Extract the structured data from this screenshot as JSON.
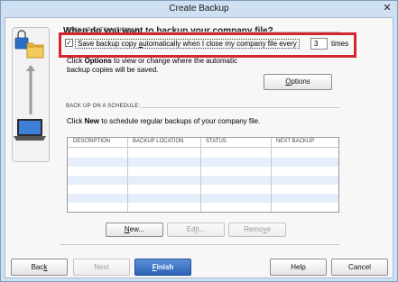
{
  "window": {
    "title": "Create Backup",
    "close_glyph": "✕"
  },
  "heading": "When do you want to backup your company file?",
  "auto_section": {
    "label": "BACK UP AUTOMATICALLY:",
    "checkbox_checked": true,
    "checkbox_mark": "✓",
    "checkbox_label_before": "Save backup copy ",
    "checkbox_label_mnemonic": "a",
    "checkbox_label_after": "utomatically when I close my company file every",
    "times_value": "3",
    "times_label": "times",
    "info_before": "Click ",
    "info_bold": "Options",
    "info_after": " to view or change where the automatic backup copies will be saved.",
    "options_button_mnemonic": "O",
    "options_button_rest": "ptions"
  },
  "schedule_section": {
    "label": "BACK UP ON A SCHEDULE:",
    "text_before": "Click ",
    "text_bold": "New",
    "text_after": " to schedule regular backups of your company file.",
    "columns": [
      "DESCRIPTION",
      "BACKUP LOCATION",
      "STATUS",
      "NEXT BACKUP"
    ],
    "new_mnemonic": "N",
    "new_rest": "ew...",
    "edit_before": "Ed",
    "edit_mnemonic": "i",
    "edit_after": "t...",
    "remove_before": "Remo",
    "remove_mnemonic": "v",
    "remove_after": "e"
  },
  "footer": {
    "back_before": "Bac",
    "back_mnemonic": "k",
    "next_label": "Next",
    "finish_before": "",
    "finish_mnemonic": "F",
    "finish_after": "inish",
    "help_label": "Help",
    "cancel_label": "Cancel"
  },
  "icons": [
    "lock-icon",
    "folder-icon",
    "arrow-up-icon",
    "laptop-icon"
  ],
  "colors": {
    "highlight_box": "#d3262e",
    "primary_button": "#2c63b8",
    "row_alt": "#e5eefa"
  }
}
